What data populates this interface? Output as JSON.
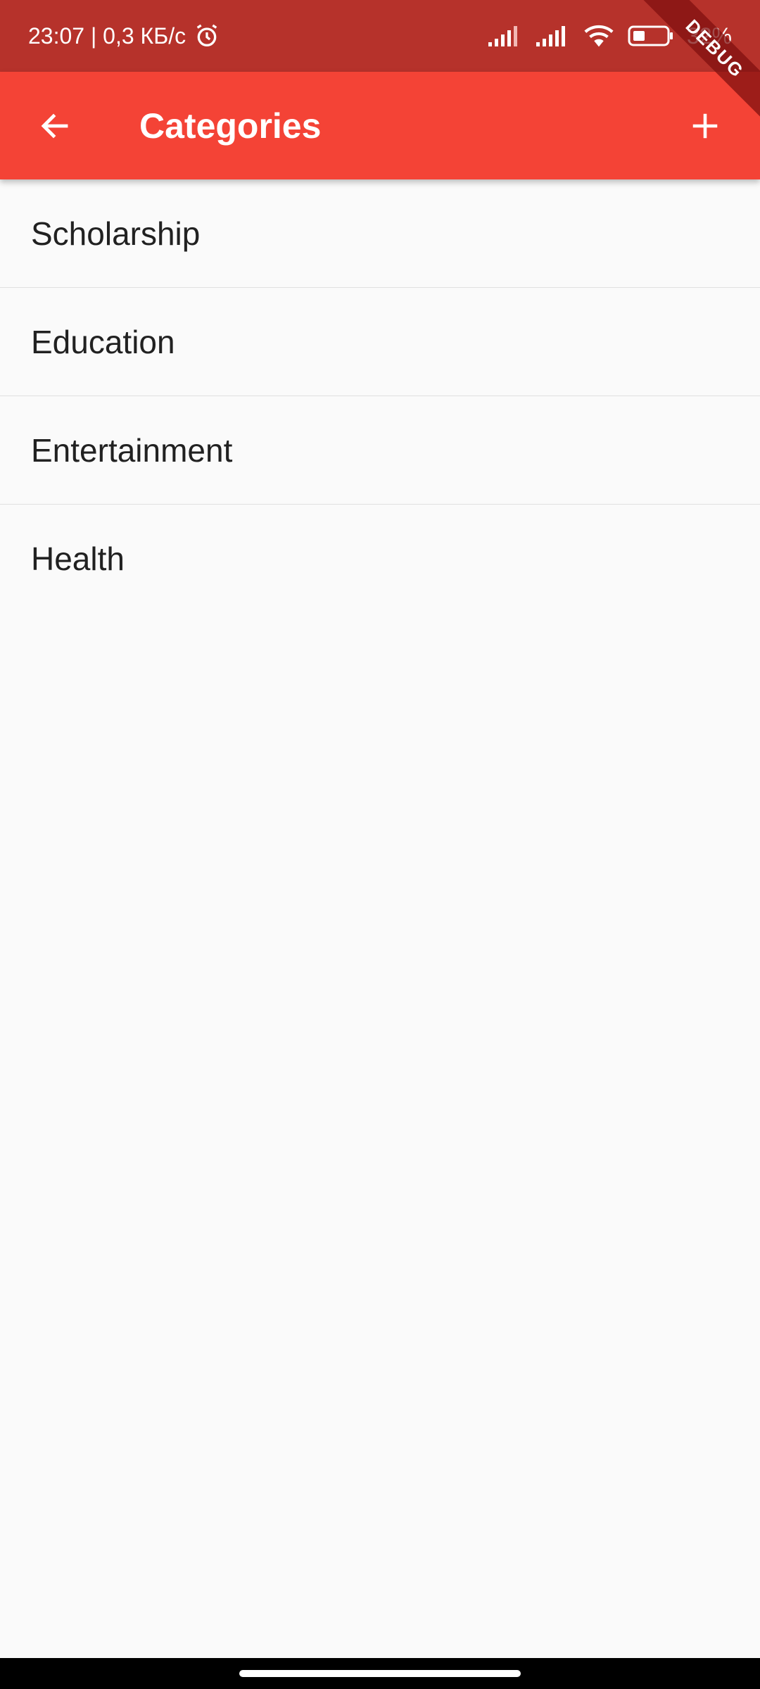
{
  "status_bar": {
    "time_and_speed": "23:07 | 0,3 КБ/с",
    "battery_text": "32%",
    "icons": [
      "alarm-icon",
      "signal-icon",
      "signal-icon",
      "wifi-icon",
      "battery-icon"
    ]
  },
  "app_bar": {
    "title": "Categories",
    "back_icon": "arrow-left-icon",
    "add_icon": "plus-icon"
  },
  "debug_banner": {
    "label": "DEBUG"
  },
  "categories": [
    {
      "label": "Scholarship"
    },
    {
      "label": "Education"
    },
    {
      "label": "Entertainment"
    },
    {
      "label": "Health"
    }
  ],
  "colors": {
    "app_bar": "#f44336",
    "status_bar": "#b6322b",
    "background": "#fafafa",
    "text": "#212121",
    "divider": "#e0e0e0"
  }
}
